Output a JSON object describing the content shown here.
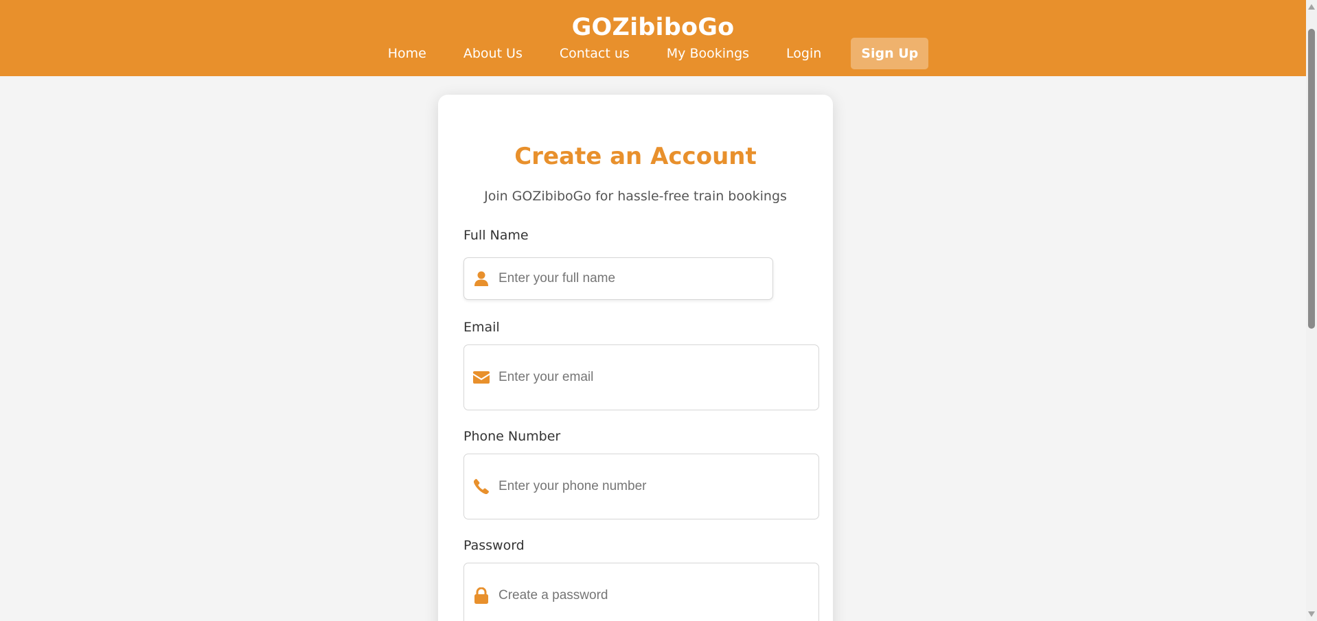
{
  "header": {
    "brand": "GOZibiboGo",
    "nav": [
      {
        "label": "Home"
      },
      {
        "label": "About Us"
      },
      {
        "label": "Contact us"
      },
      {
        "label": "My Bookings"
      },
      {
        "label": "Login"
      },
      {
        "label": "Sign Up",
        "active": true
      }
    ]
  },
  "form": {
    "title": "Create an Account",
    "subtitle": "Join GOZibiboGo for hassle-free train bookings",
    "full_name": {
      "label": "Full Name",
      "placeholder": "Enter your full name",
      "value": "",
      "icon": "user-icon"
    },
    "email": {
      "label": "Email",
      "placeholder": "Enter your email",
      "value": "",
      "icon": "envelope-icon"
    },
    "phone": {
      "label": "Phone Number",
      "placeholder": "Enter your phone number",
      "value": "",
      "icon": "phone-icon"
    },
    "password": {
      "label": "Password",
      "placeholder": "Create a password",
      "value": "",
      "icon": "lock-icon"
    }
  },
  "colors": {
    "accent": "#e8902c",
    "active_nav_bg": "#efb26d",
    "page_bg": "#f4f4f4"
  }
}
